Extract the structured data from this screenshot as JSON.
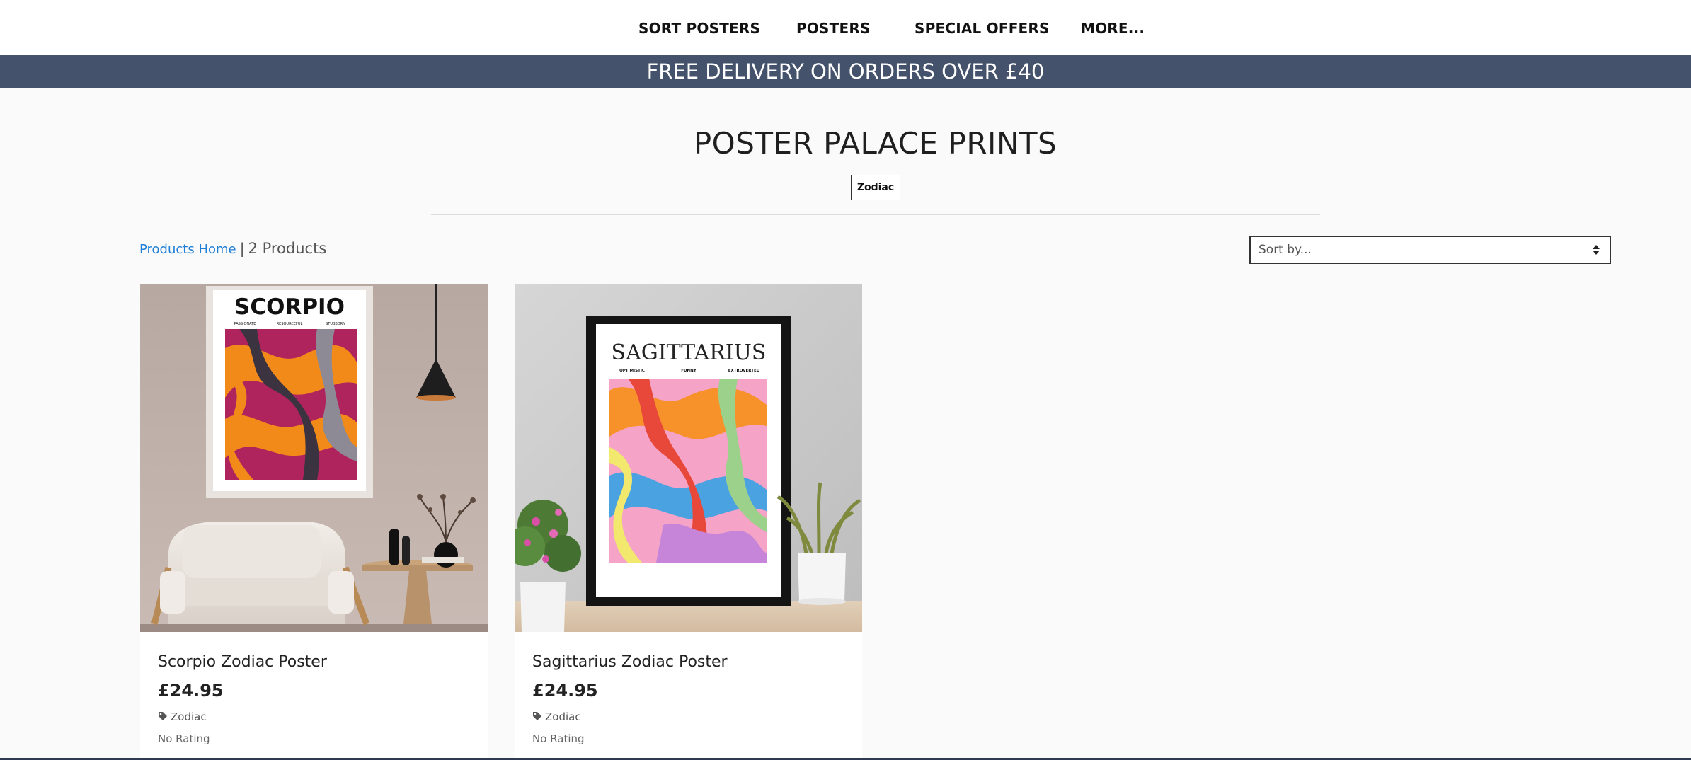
{
  "nav": {
    "items": [
      {
        "label": "SORT POSTERS"
      },
      {
        "label": "POSTERS"
      },
      {
        "label": "SPECIAL OFFERS"
      },
      {
        "label": "MORE..."
      }
    ]
  },
  "banner": {
    "text": "FREE DELIVERY ON ORDERS OVER £40"
  },
  "header": {
    "title": "POSTER PALACE PRINTS",
    "tag": "Zodiac"
  },
  "toolbar": {
    "breadcrumb_link": "Products Home",
    "separator": "|",
    "count": "2 Products",
    "sort_placeholder": "Sort by..."
  },
  "products": [
    {
      "title": "Scorpio Zodiac Poster",
      "price": "£24.95",
      "tag": "Zodiac",
      "rating": "No Rating",
      "poster_heading": "SCORPIO",
      "poster_traits": [
        "PASSIONATE",
        "RESOURCEFUL",
        "STUBBORN"
      ]
    },
    {
      "title": "Sagittarius Zodiac Poster",
      "price": "£24.95",
      "tag": "Zodiac",
      "rating": "No Rating",
      "poster_heading": "SAGITTARIUS",
      "poster_traits": [
        "OPTIMISTIC",
        "FUNNY",
        "EXTROVERTED"
      ]
    }
  ],
  "colors": {
    "banner": "#44536b",
    "link": "#1e7fd6",
    "page_bg": "#fafafa"
  }
}
